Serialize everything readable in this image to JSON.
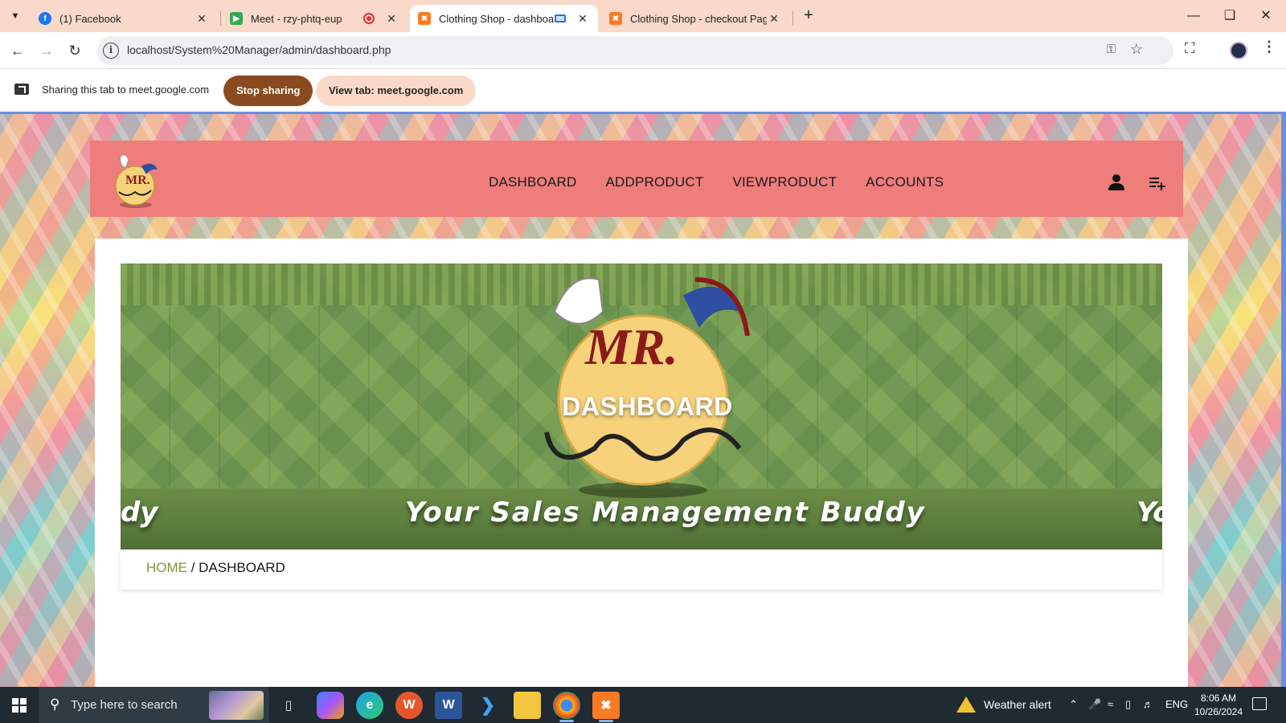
{
  "browser": {
    "tabs": [
      {
        "title": "(1) Facebook",
        "favicon": "facebook-icon",
        "color": "#1877f2"
      },
      {
        "title": "Meet - rzy-phtq-eup",
        "favicon": "google-meet-icon",
        "color": "#34a853"
      },
      {
        "title": "Clothing Shop - dashboard",
        "favicon": "xampp-icon",
        "color": "#fb7a24"
      },
      {
        "title": "Clothing Shop - checkout Page",
        "favicon": "xampp-icon",
        "color": "#fb7a24"
      }
    ],
    "url": "localhost/System%20Manager/admin/dashboard.php"
  },
  "sharebar": {
    "text": "Sharing this tab to meet.google.com",
    "stop_label": "Stop sharing",
    "view_label": "View tab: meet.google.com"
  },
  "site": {
    "nav": [
      "DASHBOARD",
      "ADDPRODUCT",
      "VIEWPRODUCT",
      "ACCOUNTS"
    ],
    "header_color": "#ee7d7c",
    "logo_text": "MR."
  },
  "hero": {
    "title": "DASHBOARD",
    "tagline": "Your Sales Management Buddy",
    "tagline_fragment_left": "dy",
    "tagline_fragment_right": "Yo",
    "logo_text": "MR."
  },
  "breadcrumb": {
    "home": "HOME",
    "separator": " / ",
    "current": "DASHBOARD"
  },
  "taskbar": {
    "search_placeholder": "Type here to search",
    "weather": "Weather alert",
    "language": "ENG",
    "time": "8:06 AM",
    "date": "10/26/2024"
  }
}
